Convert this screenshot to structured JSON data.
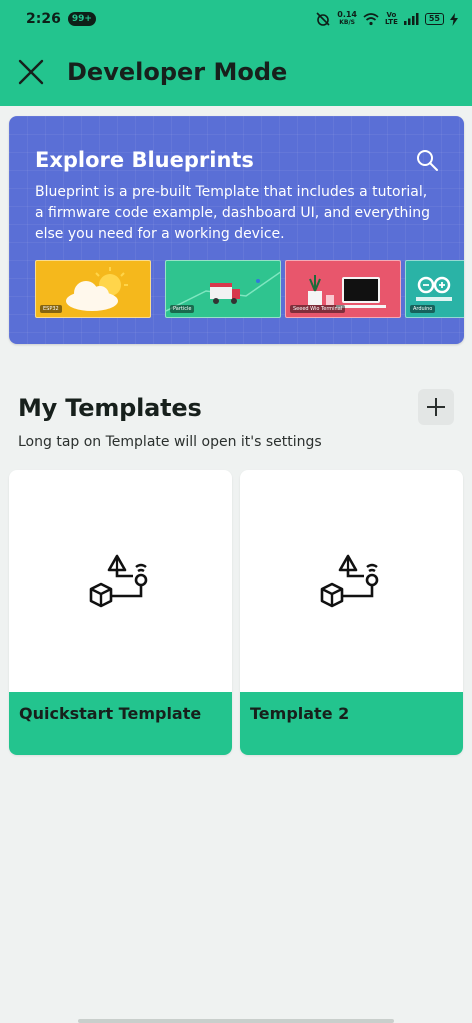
{
  "status_bar": {
    "time": "2:26",
    "notification_badge": "99+",
    "net_speed_value": "0.14",
    "net_speed_unit": "KB/S",
    "volte_top": "Vo",
    "volte_bottom": "LTE",
    "battery": "55"
  },
  "app_bar": {
    "title": "Developer Mode",
    "close_icon": "close-icon"
  },
  "blueprints": {
    "title": "Explore Blueprints",
    "description": "Blueprint is a pre-built Template that includes a tutorial, a firmware code example, dashboard UI, and everything else you need for a working device.",
    "search_icon": "search-icon",
    "thumbnails": [
      {
        "tag": "ESP32",
        "color": "#f5b81c"
      },
      {
        "tag": "Particle",
        "color": "#2fc48f"
      },
      {
        "tag": "Seeed Wio Terminal",
        "color": "#e8566c"
      },
      {
        "tag": "Arduino",
        "color": "#2ab3a6"
      }
    ]
  },
  "templates": {
    "title": "My Templates",
    "hint": "Long tap on Template will open it's settings",
    "add_icon": "plus-icon",
    "items": [
      {
        "name": "Quickstart Template"
      },
      {
        "name": "Template 2"
      }
    ]
  },
  "colors": {
    "accent": "#23c48e",
    "blueprint_bg": "#5a6fd6",
    "page_bg": "#eff2f1"
  }
}
